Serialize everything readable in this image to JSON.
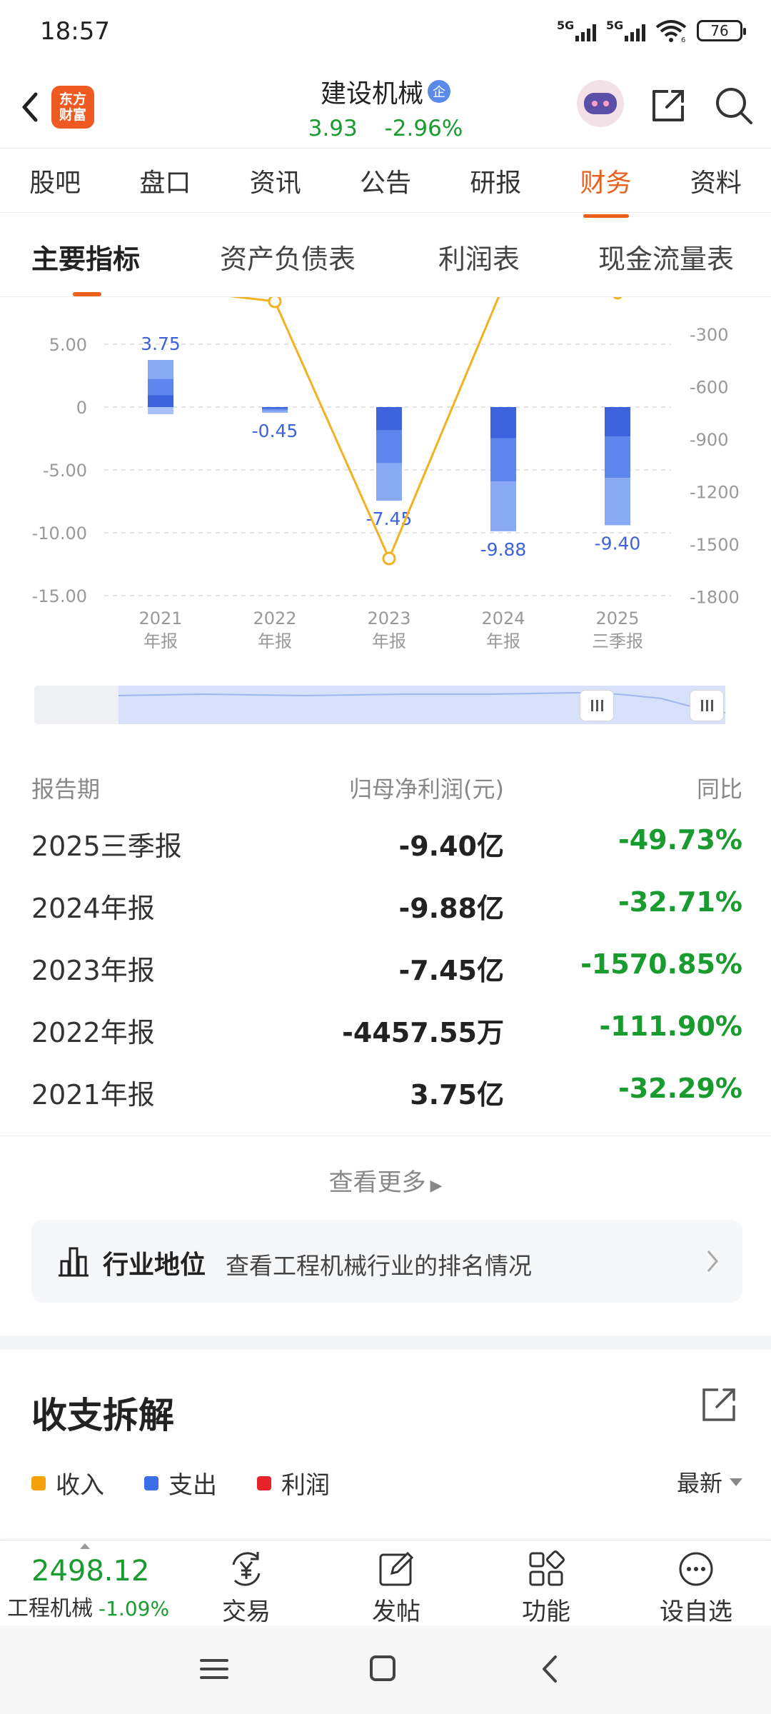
{
  "status": {
    "time": "18:57",
    "net1": "5G",
    "net2": "5G",
    "wifi_sub": "6",
    "battery": "76"
  },
  "header": {
    "logo_line1": "东方",
    "logo_line2": "财富",
    "title": "建设机械",
    "badge": "企",
    "price": "3.93",
    "change": "-2.96%",
    "colors": {
      "down": "#1a9b2f",
      "accent": "#e8601c"
    }
  },
  "tabs": [
    "股吧",
    "盘口",
    "资讯",
    "公告",
    "研报",
    "财务",
    "资料"
  ],
  "active_tab": "财务",
  "subtabs": [
    "主要指标",
    "资产负债表",
    "利润表",
    "现金流量表"
  ],
  "active_subtab": "主要指标",
  "chart_data": {
    "type": "bar",
    "categories": [
      "2021\n年报",
      "2022\n年报",
      "2023\n年报",
      "2024\n年报",
      "2025\n三季报"
    ],
    "series": [
      {
        "values": [
          3.75,
          -0.45,
          -7.45,
          -9.88,
          -9.4
        ]
      }
    ],
    "data_labels": [
      "3.75",
      "-0.45",
      "-7.45",
      "-9.88",
      "-9.40"
    ],
    "line_series_partial_visible": true,
    "y_left_ticks": [
      "5.00",
      "0",
      "-5.00",
      "-10.00",
      "-15.00"
    ],
    "y_right_ticks": [
      "-300",
      "-600",
      "-900",
      "-1200",
      "-1500",
      "-1800"
    ],
    "ylim_left": [
      -15,
      5
    ],
    "ylim_right": [
      -1800,
      -300
    ],
    "grid": true
  },
  "table": {
    "headers": [
      "报告期",
      "归母净利润(元)",
      "同比"
    ],
    "rows": [
      [
        "2025三季报",
        "-9.40亿",
        "-49.73%"
      ],
      [
        "2024年报",
        "-9.88亿",
        "-32.71%"
      ],
      [
        "2023年报",
        "-7.45亿",
        "-1570.85%"
      ],
      [
        "2022年报",
        "-4457.55万",
        "-111.90%"
      ],
      [
        "2021年报",
        "3.75亿",
        "-32.29%"
      ]
    ]
  },
  "more_label": "查看更多",
  "industry": {
    "title": "行业地位",
    "desc": "查看工程机械行业的排名情况"
  },
  "section": {
    "title": "收支拆解",
    "legend": [
      {
        "label": "收入",
        "color": "#f5a20a"
      },
      {
        "label": "支出",
        "color": "#3b6fe8"
      },
      {
        "label": "利润",
        "color": "#e8242a"
      }
    ],
    "sort_label": "最新"
  },
  "bottom": {
    "index_value": "2498.12",
    "index_name": "工程机械",
    "index_change": "-1.09%",
    "items": [
      {
        "label": "交易",
        "icon": "trade-icon"
      },
      {
        "label": "发帖",
        "icon": "post-icon"
      },
      {
        "label": "功能",
        "icon": "apps-icon"
      },
      {
        "label": "设自选",
        "icon": "more-icon"
      }
    ]
  }
}
